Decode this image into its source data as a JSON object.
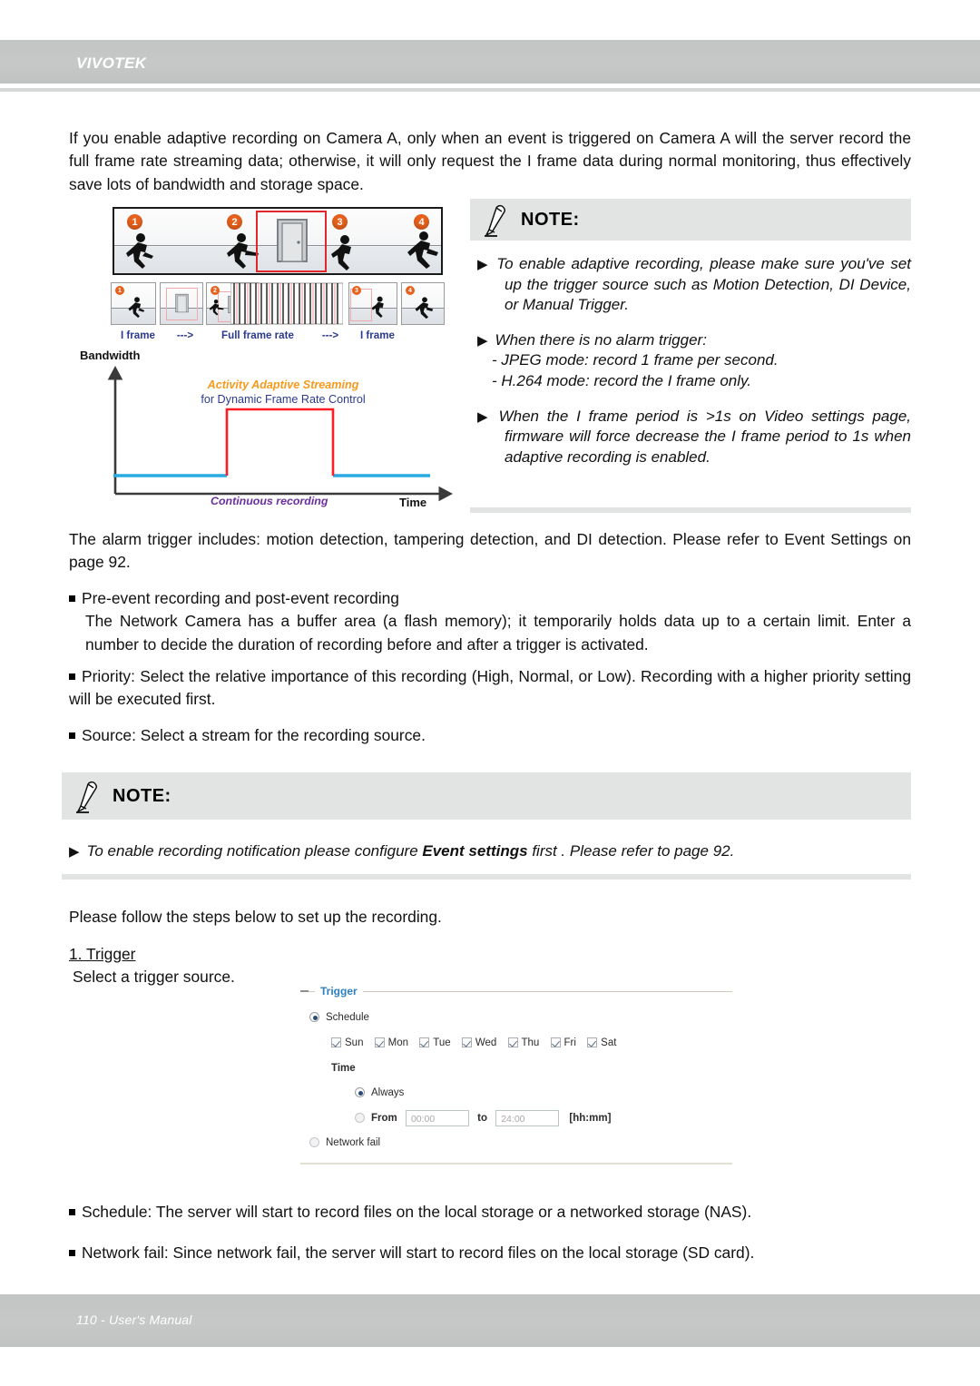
{
  "header": {
    "brand": "VIVOTEK"
  },
  "footer": {
    "text": "110 - User's Manual"
  },
  "intro_paragraph": "If you enable adaptive recording on Camera A, only when an event is triggered on Camera A will the server record the full frame rate streaming data; otherwise, it will only request the I frame data during normal monitoring, thus effectively save lots of bandwidth and storage space.",
  "note1": {
    "title": "NOTE:",
    "lines": [
      "To enable adaptive recording, please make sure you've set up the trigger source such as Motion Detection, DI Device, or Manual Trigger.",
      "When there is no alarm trigger:",
      "When the I frame period is >1s on Video settings page, firmware will force decrease the I frame period to 1s when adaptive recording is enabled."
    ],
    "sub_lines": [
      "- JPEG mode: record 1 frame per second.",
      "- H.264 mode: record the I frame only."
    ],
    "bullet_glyph": "▶"
  },
  "note2": {
    "title": "NOTE:",
    "bullet_glyph": "▶",
    "line_part1": "To enable recording notification please configure ",
    "line_bold": "Event settings",
    "line_part2": " first . Please refer to page 92."
  },
  "diagram": {
    "badges": [
      "1",
      "2",
      "3",
      "4"
    ],
    "thumb_badges": [
      "1",
      "2",
      "3",
      "4"
    ],
    "frame_labels": [
      "I frame",
      "--->",
      "Full frame rate",
      "--->",
      "I frame"
    ],
    "label_color": "#2b3a8f",
    "badge_color": "#e8611c",
    "door_highlight_color": "#e1262c"
  },
  "chart_data": {
    "type": "line",
    "title": "Bandwidth",
    "xlabel": "Time",
    "ylabel": "Bandwidth",
    "annotation_primary": "Activity Adaptive Streaming",
    "annotation_secondary": "for Dynamic Frame Rate Control",
    "annotation_baseline": "Continuous recording",
    "grid": false,
    "legend": "none",
    "xlim": [
      0,
      100
    ],
    "ylim": [
      0,
      100
    ],
    "series": [
      {
        "name": "Continuous recording",
        "color": "#29ABE2",
        "x": [
          2,
          36,
          36,
          78,
          78,
          100
        ],
        "values": [
          18,
          18,
          18,
          18,
          18,
          18
        ]
      },
      {
        "name": "Activity Adaptive Streaming",
        "color": "#FF1D25",
        "x": [
          36,
          36,
          78,
          78
        ],
        "values": [
          18,
          62,
          62,
          18
        ]
      }
    ]
  },
  "body": {
    "alarm_paragraph": "The alarm trigger includes: motion detection, tampering detection, and DI detection. Please refer to Event Settings on page 92.",
    "bullets": [
      {
        "head": "Pre-event recording and post-event recording",
        "sub": "The Network Camera has a buffer area (a flash memory); it temporarily holds data up to a certain limit. Enter a number to decide the duration of recording before and after a trigger is activated."
      },
      {
        "head": "Priority: Select the relative importance of this recording (High, Normal, or Low). Recording with a higher priority setting will be executed first.",
        "sub": ""
      },
      {
        "head": "Source: Select a stream for the recording source.",
        "sub": ""
      }
    ],
    "steps_intro": "Please follow the steps below to set up the recording.",
    "step1_title": "1. Trigger",
    "step1_desc": "Select a trigger source.",
    "tail_bullets": [
      "Schedule: The server will start to record files on the local storage or a networked storage (NAS).",
      "Network fail: Since network fail, the server will start to record files on the local storage (SD card)."
    ]
  },
  "trigger_form": {
    "legend": "Trigger",
    "schedule_label": "Schedule",
    "days": [
      "Sun",
      "Mon",
      "Tue",
      "Wed",
      "Thu",
      "Fri",
      "Sat"
    ],
    "time_label": "Time",
    "always_label": "Always",
    "from_label": "From",
    "from_value": "00:00",
    "to_label": "to",
    "to_value": "24:00",
    "format_hint": "[hh:mm]",
    "network_fail_label": "Network fail",
    "accent_color": "#2d7fc1"
  }
}
